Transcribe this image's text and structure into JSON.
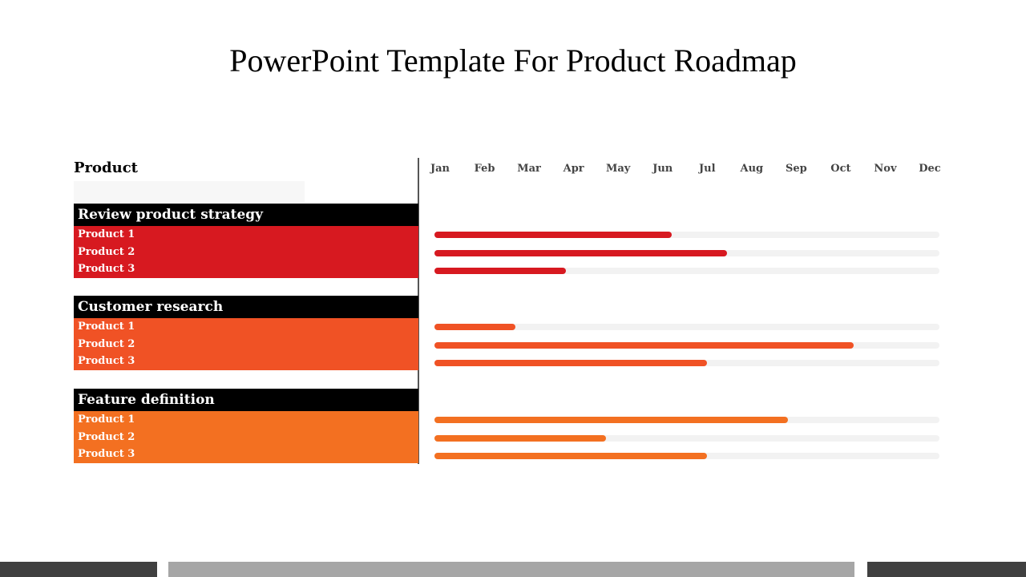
{
  "title": "PowerPoint Template For Product Roadmap",
  "product_header": "Product",
  "colors": {
    "group_header_bg": "#000000",
    "track": "#f2f2f2",
    "footer_dark": "#404040",
    "footer_light": "#a6a6a6"
  },
  "chart_data": {
    "type": "bar",
    "orientation": "horizontal",
    "title": "PowerPoint Template For Product Roadmap",
    "x_axis": {
      "tick_labels": [
        "Jan",
        "Feb",
        "Mar",
        "Apr",
        "May",
        "Jun",
        "Jul",
        "Aug",
        "Sep",
        "Oct",
        "Nov",
        "Dec"
      ],
      "range_fraction": [
        0,
        1
      ]
    },
    "groups": [
      {
        "name": "Review product strategy",
        "color": "#d71920",
        "items": [
          {
            "label": "Product 1",
            "progress": 0.47
          },
          {
            "label": "Product 2",
            "progress": 0.58
          },
          {
            "label": "Product 3",
            "progress": 0.26
          }
        ]
      },
      {
        "name": "Customer research",
        "color": "#f05225",
        "items": [
          {
            "label": "Product 1",
            "progress": 0.16
          },
          {
            "label": "Product 2",
            "progress": 0.83
          },
          {
            "label": "Product 3",
            "progress": 0.54
          }
        ]
      },
      {
        "name": "Feature definition",
        "color": "#f37021",
        "items": [
          {
            "label": "Product 1",
            "progress": 0.7
          },
          {
            "label": "Product 2",
            "progress": 0.34
          },
          {
            "label": "Product 3",
            "progress": 0.54
          }
        ]
      }
    ]
  }
}
